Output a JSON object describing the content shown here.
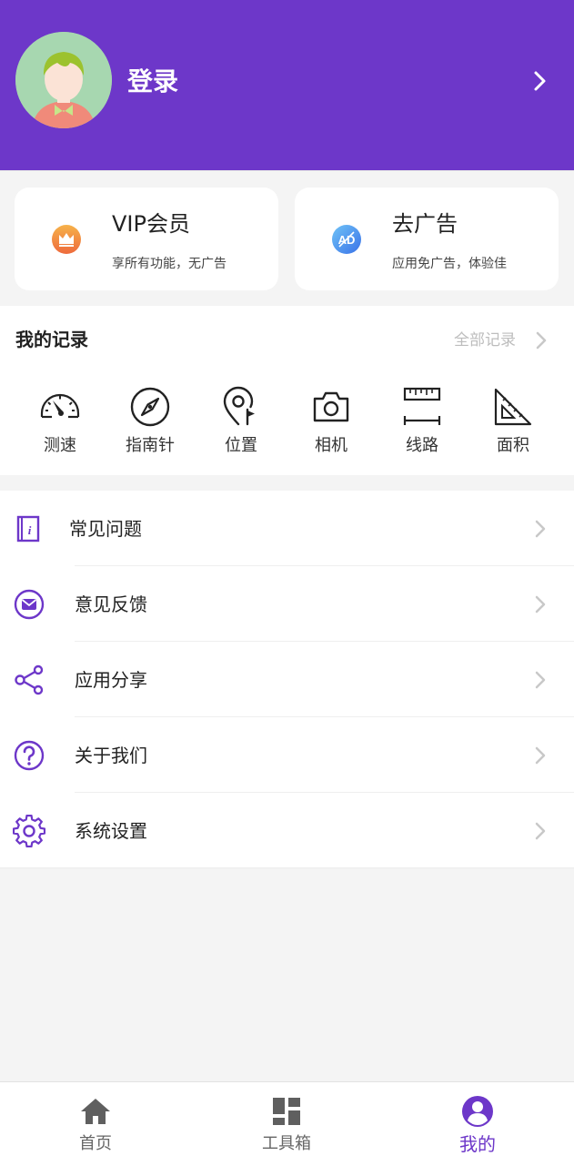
{
  "header": {
    "login_label": "登录"
  },
  "cards": [
    {
      "title": "VIP会员",
      "subtitle": "享所有功能，无广告",
      "icon": "crown-icon",
      "color": "#f08a3c"
    },
    {
      "title": "去广告",
      "subtitle": "应用免广告，体验佳",
      "icon": "ad-icon",
      "color": "#3f8ef0"
    }
  ],
  "records": {
    "title": "我的记录",
    "all_label": "全部记录",
    "tools": [
      {
        "label": "测速",
        "icon": "speedometer-icon"
      },
      {
        "label": "指南针",
        "icon": "compass-icon"
      },
      {
        "label": "位置",
        "icon": "location-pin-icon"
      },
      {
        "label": "相机",
        "icon": "camera-icon"
      },
      {
        "label": "线路",
        "icon": "ruler-icon"
      },
      {
        "label": "面积",
        "icon": "set-square-icon"
      }
    ]
  },
  "menu": [
    {
      "label": "常见问题",
      "icon": "info-book-icon"
    },
    {
      "label": "意见反馈",
      "icon": "mail-icon"
    },
    {
      "label": "应用分享",
      "icon": "share-icon"
    },
    {
      "label": "关于我们",
      "icon": "question-icon"
    },
    {
      "label": "系统设置",
      "icon": "gear-icon"
    }
  ],
  "tabs": [
    {
      "label": "首页",
      "icon": "home-icon"
    },
    {
      "label": "工具箱",
      "icon": "dashboard-icon"
    },
    {
      "label": "我的",
      "icon": "user-icon",
      "active": true
    }
  ],
  "colors": {
    "accent": "#6d37c9",
    "background": "#f4f4f4"
  }
}
